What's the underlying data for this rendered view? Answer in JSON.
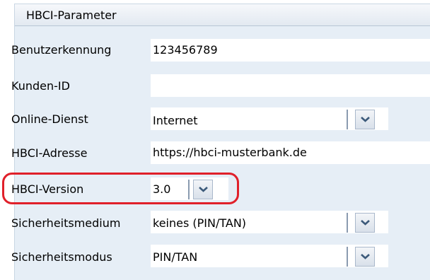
{
  "panel": {
    "title": "HBCI-Parameter"
  },
  "fields": {
    "benutzerkennung": {
      "label": "Benutzerkennung",
      "value": "123456789"
    },
    "kunden_id": {
      "label": "Kunden-ID",
      "value": ""
    },
    "online_dienst": {
      "label": "Online-Dienst",
      "value": "Internet"
    },
    "hbci_adresse": {
      "label": "HBCI-Adresse",
      "value": "https://hbci-musterbank.de"
    },
    "hbci_version": {
      "label": "HBCI-Version",
      "value": "3.0"
    },
    "sicherheitsmedium": {
      "label": "Sicherheitsmedium",
      "value": "keines (PIN/TAN)"
    },
    "sicherheitsmodus": {
      "label": "Sicherheitsmodus",
      "value": "PIN/TAN"
    }
  },
  "icons": {
    "dropdown": "chevron-down-icon"
  },
  "colors": {
    "panel_background": "#e6eef6",
    "highlight": "#e0202a"
  }
}
